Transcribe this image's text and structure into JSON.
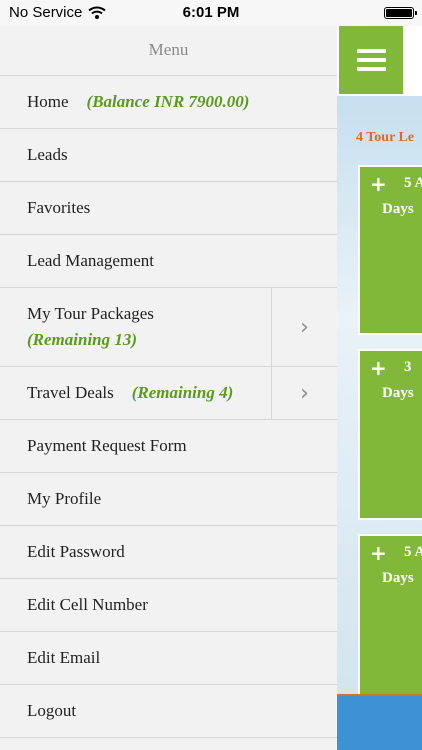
{
  "status_bar": {
    "carrier": "No Service",
    "time": "6:01 PM"
  },
  "drawer": {
    "title": "Menu",
    "items": [
      {
        "label": "Home",
        "accent": "(Balance INR 7900.00)"
      },
      {
        "label": "Leads"
      },
      {
        "label": "Favorites"
      },
      {
        "label": "Lead Management"
      },
      {
        "label": "My Tour Packages",
        "accent": "(Remaining 13)"
      },
      {
        "label": "Travel Deals",
        "accent": "(Remaining 4)"
      },
      {
        "label": "Payment Request Form"
      },
      {
        "label": "My Profile"
      },
      {
        "label": "Edit Password"
      },
      {
        "label": "Edit Cell Number"
      },
      {
        "label": "Edit Email"
      },
      {
        "label": "Logout"
      }
    ]
  },
  "background_app": {
    "leads_label": "4 Tour Le",
    "cards": [
      {
        "plus": "+",
        "num": "5 A",
        "days": "Days"
      },
      {
        "plus": "+",
        "num": "3",
        "days": "Days"
      },
      {
        "plus": "+",
        "num": "5 A",
        "days": "Days"
      }
    ]
  },
  "colors": {
    "accent_green": "#5a9a1e",
    "card_green": "#82b83a",
    "leads_orange": "#e06a1f",
    "bottom_blue": "#3d92d4"
  }
}
